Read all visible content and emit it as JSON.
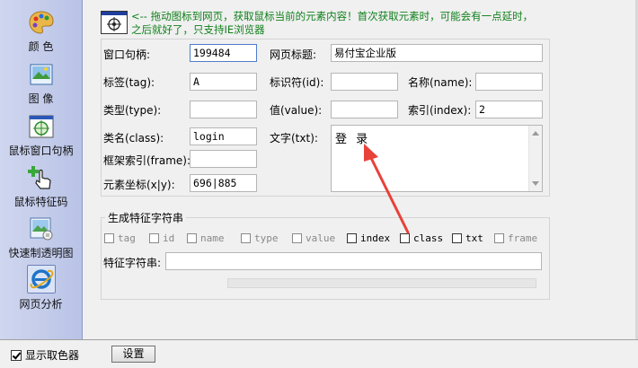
{
  "sidebar": {
    "items": [
      {
        "label": "颜 色",
        "icon": "palette-icon"
      },
      {
        "label": "图 像",
        "icon": "picture-icon"
      },
      {
        "label": "鼠标窗口句柄",
        "icon": "crosshair-window-icon"
      },
      {
        "label": "鼠标特征码",
        "icon": "hand-cursor-plus-icon"
      },
      {
        "label": "快速制透明图",
        "icon": "transparent-image-icon"
      },
      {
        "label": "网页分析",
        "icon": "ie-browser-icon",
        "active": true
      }
    ]
  },
  "hint": {
    "text": "<-- 拖动图标到网页，获取鼠标当前的元素内容！首次获取元素时，可能会有一点延时，之后就好了，只支持IE浏览器"
  },
  "fields": {
    "window_handle": {
      "label": "窗口句柄:",
      "value": "199484"
    },
    "page_title": {
      "label": "网页标题:",
      "value": "易付宝企业版"
    },
    "tag": {
      "label": "标签(tag):",
      "value": "A"
    },
    "id": {
      "label": "标识符(id):",
      "value": ""
    },
    "name": {
      "label": "名称(name):",
      "value": ""
    },
    "type": {
      "label": "类型(type):",
      "value": ""
    },
    "value": {
      "label": "值(value):",
      "value": ""
    },
    "index": {
      "label": "索引(index):",
      "value": "2"
    },
    "class": {
      "label": "类名(class):",
      "value": "login"
    },
    "text": {
      "label": "文字(txt):",
      "value": "登 录"
    },
    "frame_index": {
      "label": "框架索引(frame):",
      "value": ""
    },
    "coords": {
      "label": "元素坐标(x|y):",
      "value": "696|885"
    }
  },
  "feature": {
    "legend": "生成特征字符串",
    "checks": [
      {
        "label": "tag",
        "checked": false
      },
      {
        "label": "id",
        "checked": false
      },
      {
        "label": "name",
        "checked": false
      },
      {
        "label": "type",
        "checked": false
      },
      {
        "label": "value",
        "checked": false
      },
      {
        "label": "index",
        "checked": false
      },
      {
        "label": "class",
        "checked": false
      },
      {
        "label": "txt",
        "checked": false
      },
      {
        "label": "frame",
        "checked": false
      }
    ],
    "string_label": "特征字符串:",
    "string_value": ""
  },
  "bottom": {
    "show_picker_label": "显示取色器",
    "show_picker_checked": true,
    "settings_label": "设置"
  },
  "colors": {
    "hint_text": "#10801c",
    "annotation_arrow": "#e8423a",
    "rail_bg": "#c4cdea"
  }
}
